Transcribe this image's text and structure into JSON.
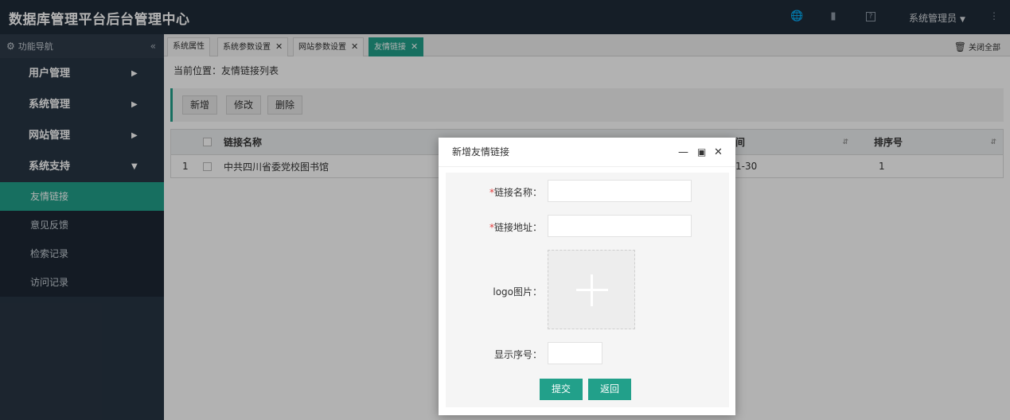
{
  "header": {
    "title": "数据库管理平台后台管理中心",
    "user": "系统管理员",
    "icons": [
      "globe-icon",
      "book-icon",
      "help-icon",
      "more-icon"
    ]
  },
  "sidebar": {
    "head_label": "功能导航",
    "items": [
      {
        "label": "用户管理"
      },
      {
        "label": "系统管理"
      },
      {
        "label": "网站管理"
      },
      {
        "label": "系统支持"
      }
    ],
    "sub_items": [
      {
        "label": "友情链接",
        "active": true
      },
      {
        "label": "意见反馈"
      },
      {
        "label": "检索记录"
      },
      {
        "label": "访问记录"
      }
    ]
  },
  "tabs": [
    {
      "label": "系统属性",
      "closable": false
    },
    {
      "label": "系统参数设置",
      "closable": true
    },
    {
      "label": "网站参数设置",
      "closable": true
    },
    {
      "label": "友情链接",
      "closable": true,
      "active": true
    }
  ],
  "close_all": "关闭全部",
  "main": {
    "breadcrumb": "当前位置：友情链接列表",
    "toolbar": {
      "add": "新增",
      "edit": "修改",
      "delete": "删除"
    },
    "columns": [
      "链接名称",
      "间",
      "排序号"
    ],
    "rows": [
      {
        "index": "1",
        "name": "中共四川省委党校图书馆",
        "time": "1-30",
        "order": "1"
      }
    ]
  },
  "modal": {
    "title": "新增友情链接",
    "fields": {
      "name_label": "链接名称：",
      "url_label": "链接地址：",
      "logo_label": "logo图片：",
      "order_label": "显示序号：",
      "required_mark": "*"
    },
    "submit": "提交",
    "back": "返回"
  },
  "colors": {
    "accent": "#22a08a",
    "header_bg": "#1f2b38",
    "sidebar_bg": "#283544"
  }
}
